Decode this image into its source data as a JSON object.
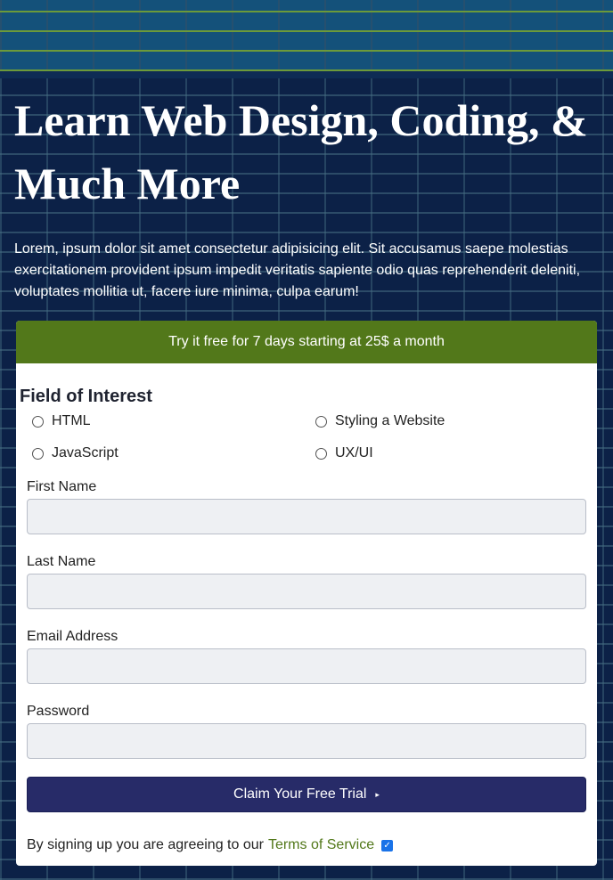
{
  "hero": {
    "title": "Learn Web Design, Coding, & Much More",
    "description": "Lorem, ipsum dolor sit amet consectetur adipisicing elit. Sit accusamus saepe molestias exercitationem provident ipsum impedit veritatis sapiente odio quas reprehenderit deleniti, voluptates mollitia ut, facere iure minima, culpa earum!"
  },
  "card": {
    "banner": "Try it free for 7 days starting at 25$ a month",
    "interest_title": "Field of Interest",
    "interests": [
      "HTML",
      "Styling a Website",
      "JavaScript",
      "UX/UI"
    ],
    "fields": {
      "first_name": {
        "label": "First Name",
        "value": ""
      },
      "last_name": {
        "label": "Last Name",
        "value": ""
      },
      "email": {
        "label": "Email Address",
        "value": ""
      },
      "password": {
        "label": "Password",
        "value": ""
      }
    },
    "submit_label": "Claim Your Free Trial",
    "submit_arrow": "▸",
    "terms_text": "By signing up you are agreeing to our",
    "terms_link": "Terms of Service",
    "terms_checked": true
  },
  "colors": {
    "banner": "#52781a",
    "button": "#272b68",
    "link": "#52781a",
    "background": "#0c2147"
  },
  "icons": {
    "arrow": "arrow-right-icon",
    "checkbox": "checkbox-checked-icon"
  }
}
